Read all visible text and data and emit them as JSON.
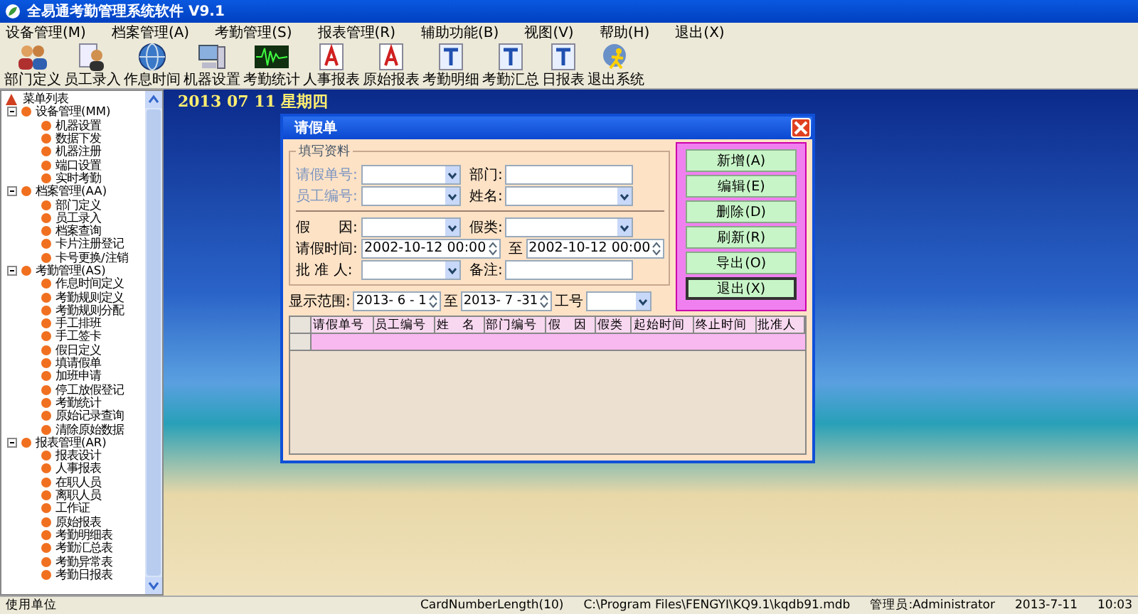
{
  "window": {
    "title": "全易通考勤管理系统软件 V9.1"
  },
  "menu": [
    "设备管理(M)",
    "档案管理(A)",
    "考勤管理(S)",
    "报表管理(R)",
    "辅助功能(B)",
    "视图(V)",
    "帮助(H)",
    "退出(X)"
  ],
  "toolbar": [
    {
      "label": "部门定义",
      "kind": "people"
    },
    {
      "label": "员工录入",
      "kind": "person"
    },
    {
      "label": "作息时间",
      "kind": "globe"
    },
    {
      "label": "机器设置",
      "kind": "computer"
    },
    {
      "label": "考勤统计",
      "kind": "wave"
    },
    {
      "label": "人事报表",
      "kind": "docA"
    },
    {
      "label": "原始报表",
      "kind": "docA"
    },
    {
      "label": "考勤明细",
      "kind": "docT"
    },
    {
      "label": "考勤汇总",
      "kind": "docT"
    },
    {
      "label": "日报表",
      "kind": "docT"
    },
    {
      "label": "退出系统",
      "kind": "exit"
    }
  ],
  "sidebar": {
    "root": "菜单列表",
    "children": [
      {
        "label": "设备管理(MM)",
        "expanded": true,
        "children": [
          {
            "label": "机器设置"
          },
          {
            "label": "数据下发"
          },
          {
            "label": "机器注册"
          },
          {
            "label": "端口设置"
          },
          {
            "label": "实时考勤"
          }
        ]
      },
      {
        "label": "档案管理(AA)",
        "expanded": true,
        "children": [
          {
            "label": "部门定义"
          },
          {
            "label": "员工录入"
          },
          {
            "label": "档案查询"
          },
          {
            "label": "卡片注册登记"
          },
          {
            "label": "卡号更换/注销"
          }
        ]
      },
      {
        "label": "考勤管理(AS)",
        "expanded": true,
        "children": [
          {
            "label": "作息时间定义"
          },
          {
            "label": "考勤规则定义"
          },
          {
            "label": "考勤规则分配"
          },
          {
            "label": "手工排班"
          },
          {
            "label": "手工签卡"
          },
          {
            "label": "假日定义"
          },
          {
            "label": "填请假单"
          },
          {
            "label": "加班申请"
          },
          {
            "label": "停工放假登记"
          },
          {
            "label": "考勤统计"
          },
          {
            "label": "原始记录查询"
          },
          {
            "label": "清除原始数据"
          }
        ]
      },
      {
        "label": "报表管理(AR)",
        "expanded": true,
        "children": [
          {
            "label": "报表设计"
          },
          {
            "label": "人事报表"
          },
          {
            "label": "在职人员"
          },
          {
            "label": "离职人员"
          },
          {
            "label": "工作证"
          },
          {
            "label": "原始报表"
          },
          {
            "label": "考勤明细表"
          },
          {
            "label": "考勤汇总表"
          },
          {
            "label": "考勤异常表"
          },
          {
            "label": "考勤日报表"
          }
        ]
      }
    ]
  },
  "desktop": {
    "date": "2013 07 11 星期四"
  },
  "dialog": {
    "title": "请假单",
    "group": "填写资料",
    "rows": [
      [
        {
          "label": "请假单号:",
          "kind": "combo",
          "disabled": true
        },
        {
          "label": "部门:",
          "kind": "text",
          "disabled": false
        }
      ],
      [
        {
          "label": "员工编号:",
          "kind": "combo",
          "disabled": true
        },
        {
          "label": "姓名:",
          "kind": "combo",
          "disabled": false
        }
      ],
      [
        {
          "label": "假　　因:",
          "kind": "combo",
          "disabled": false
        },
        {
          "label": "假类:",
          "kind": "combo",
          "disabled": false
        }
      ],
      [
        {
          "label": "请假时间:",
          "kind": "datetime",
          "value": "2002-10-12 00:00",
          "disabled": false
        },
        {
          "label": "至",
          "kind": "datetime",
          "value": "2002-10-12 00:00",
          "disabled": false
        }
      ],
      [
        {
          "label": "批 准 人:",
          "kind": "combo",
          "disabled": false
        },
        {
          "label": "备注:",
          "kind": "text",
          "disabled": false
        }
      ]
    ],
    "range": {
      "label": "显示范围:",
      "from": "2013- 6 - 1",
      "sep": "至",
      "to": "2013- 7 -31",
      "id_label": "工号"
    },
    "buttons": [
      {
        "label": "新增(A)",
        "selected": false
      },
      {
        "label": "编辑(E)",
        "selected": false
      },
      {
        "label": "删除(D)",
        "selected": false
      },
      {
        "label": "刷新(R)",
        "selected": false
      },
      {
        "label": "导出(O)",
        "selected": false
      },
      {
        "label": "退出(X)",
        "selected": true
      }
    ],
    "table": {
      "columns": [
        "请假单号",
        "员工编号",
        "姓　名",
        "部门编号",
        "假　因",
        "假类",
        "起始时间",
        "终止时间",
        "批准人"
      ]
    }
  },
  "status_bar": [
    "使用单位",
    "CardNumberLength(10)",
    "C:\\Program Files\\FENGYI\\KQ9.1\\kqdb91.mdb",
    "管理员:Administrator",
    "2013-7-11",
    "10:03"
  ]
}
